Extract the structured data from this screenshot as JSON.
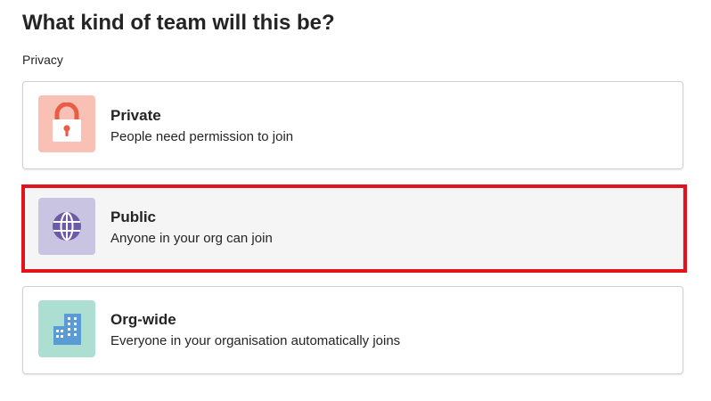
{
  "heading": "What kind of team will this be?",
  "privacy_label": "Privacy",
  "options": [
    {
      "id": "private",
      "title": "Private",
      "description": "People need permission to join",
      "icon": "lock-icon",
      "tile_color": "#f9c0b5",
      "icon_color": "#e85d46"
    },
    {
      "id": "public",
      "title": "Public",
      "description": "Anyone in your org can join",
      "icon": "globe-icon",
      "tile_color": "#c9c4e2",
      "icon_color": "#6d5ba8",
      "highlighted": true
    },
    {
      "id": "org-wide",
      "title": "Org-wide",
      "description": "Everyone in your organisation automatically joins",
      "icon": "building-icon",
      "tile_color": "#acdfd2",
      "icon_color": "#5b9bd5"
    }
  ],
  "highlight_color": "#e3121d"
}
